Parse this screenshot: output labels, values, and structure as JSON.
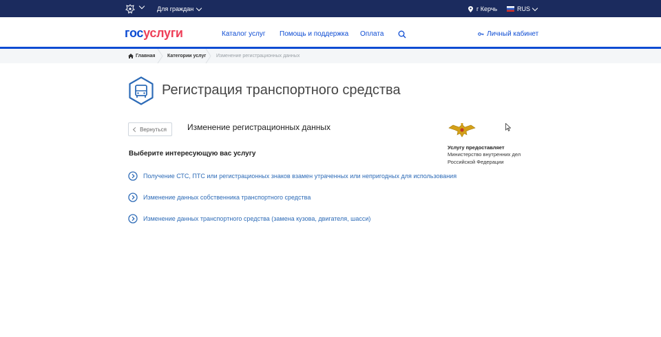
{
  "topbar": {
    "citizens_label": "Для граждан",
    "city": "г Керчь",
    "language": "RUS"
  },
  "header": {
    "logo_part1": "гос",
    "logo_part2": "услуги",
    "nav": [
      "Каталог услуг",
      "Помощь и поддержка",
      "Оплата"
    ],
    "cabinet_label": "Личный кабинет"
  },
  "breadcrumbs": {
    "home": "Главная",
    "categories": "Категории услуг",
    "current": "Изменение регистрационных данных"
  },
  "page": {
    "title": "Регистрация транспортного средства",
    "back_label": "Вернуться",
    "subtitle": "Изменение регистрационных данных",
    "question": "Выберите интересующую вас услугу"
  },
  "services": [
    "Получение СТС, ПТС или регистрационных знаков взамен утраченных или непригодных для использования",
    "Изменение данных собственника транспортного средства",
    "Изменение данных транспортного средства (замена кузова, двигателя, шасси)"
  ],
  "provider": {
    "heading": "Услугу предоставляет",
    "name": "Министерство внутренних дел Российской Федерации"
  },
  "colors": {
    "topbar": "#1b2b5e",
    "brand_blue": "#0d4cd3",
    "brand_red": "#ee3f58",
    "link": "#2d6bb7"
  }
}
